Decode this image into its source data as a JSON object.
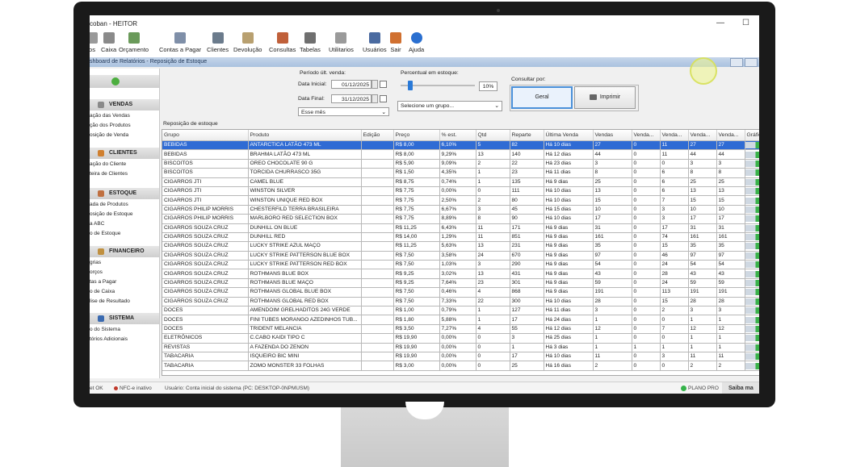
{
  "window": {
    "title": "coban - HEITOR",
    "minimize_glyph": "—",
    "maximize_glyph": "☐"
  },
  "toolbar": {
    "items": [
      {
        "label": "os",
        "icon": "document-icon",
        "color": "#9a9a9a"
      },
      {
        "label": "Caixa",
        "icon": "cart-icon",
        "color": "#8a8a8a"
      },
      {
        "label": "Orçamento",
        "icon": "calculator-icon",
        "color": "#6a9a5a"
      },
      {
        "label": "Contas a Pagar",
        "icon": "bills-icon",
        "color": "#7f8fa8"
      },
      {
        "label": "Clientes",
        "icon": "clients-icon",
        "color": "#6b7b8c"
      },
      {
        "label": "Devolução",
        "icon": "return-icon",
        "color": "#b8a070"
      },
      {
        "label": "Consultas",
        "icon": "consult-icon",
        "color": "#c0603a"
      },
      {
        "label": "Tabelas",
        "icon": "tables-icon",
        "color": "#6f6f6f"
      },
      {
        "label": "Utilitarios",
        "icon": "gear-icon",
        "color": "#9a9a9a"
      },
      {
        "label": "Usuários",
        "icon": "user-icon",
        "color": "#4a6aa0"
      },
      {
        "label": "Sair",
        "icon": "exit-icon",
        "color": "#d07030"
      },
      {
        "label": "Ajuda",
        "icon": "help-icon",
        "color": "#2a6fd0"
      }
    ]
  },
  "breadcrumb": "shboard de Relatórios - Reposição de Estoque",
  "sidebar": {
    "sections": [
      {
        "title": "VENDAS",
        "icon_color": "#8a8a8a",
        "items": [
          "ação das Vendas",
          "ção dos Produtos",
          "osição de Venda"
        ]
      },
      {
        "title": "CLIENTES",
        "icon_color": "#d08030",
        "items": [
          "ação do Cliente",
          "teira de Clientes"
        ]
      },
      {
        "title": "ESTOQUE",
        "icon_color": "#c07040",
        "items": [
          "ada de Produtos",
          "osição de Estoque",
          "a ABC",
          "o de Estoque"
        ]
      },
      {
        "title": "FINANCEIRO",
        "icon_color": "#c09040",
        "items": [
          "grias",
          "orços",
          "tas a Pagar",
          "o de Caixa",
          "lise de Resultado"
        ]
      },
      {
        "title": "SISTEMA",
        "icon_color": "#3a6ab0",
        "items": [
          "o do Sistema",
          "tórios Adicionais"
        ]
      }
    ]
  },
  "filters": {
    "period_label": "Período últ. venda:",
    "start_label": "Data Inicial:",
    "start_value": "01/12/2025",
    "end_label": "Data Final:",
    "end_value": "31/12/2025",
    "month_select": "Esse mês",
    "stock_percent_label": "Percentual em estoque:",
    "stock_percent_value": "10%",
    "stock_percent_fraction": 0.1,
    "group_select": "Selecione um grupo...",
    "consult_label": "Consultar por:",
    "general_button": "Geral",
    "print_button": "Imprimir"
  },
  "grid": {
    "title": "Reposição de estoque",
    "columns": [
      "Grupo",
      "Produto",
      "Edição",
      "Preço",
      "% est.",
      "Qtd",
      "Reparte",
      "Última Venda",
      "Vendas",
      "Venda...",
      "Venda...",
      "Venda...",
      "Venda...",
      "Gráfic"
    ],
    "rows": [
      [
        "BEBIDAS",
        "ANTARCTICA LATÃO 473 ML",
        "",
        "R$ 8,00",
        "6,10%",
        "5",
        "82",
        "Há 10 dias",
        "27",
        "0",
        "11",
        "27",
        "27"
      ],
      [
        "BEBIDAS",
        "BRAHMA LATÃO 473 ML",
        "",
        "R$ 8,00",
        "9,29%",
        "13",
        "140",
        "Há 12 dias",
        "44",
        "0",
        "11",
        "44",
        "44"
      ],
      [
        "BISCOITOS",
        "OREO CHOCOLATE 90 G",
        "",
        "R$ 5,90",
        "9,09%",
        "2",
        "22",
        "Há 23 dias",
        "3",
        "0",
        "0",
        "3",
        "3"
      ],
      [
        "BISCOITOS",
        "TORCIDA CHURRASCO 35G",
        "",
        "R$ 1,50",
        "4,35%",
        "1",
        "23",
        "Há 11 dias",
        "8",
        "0",
        "6",
        "8",
        "8"
      ],
      [
        "CIGARROS JTI",
        "CAMEL BLUE",
        "",
        "R$ 8,75",
        "0,74%",
        "1",
        "135",
        "Há 9 dias",
        "25",
        "0",
        "6",
        "25",
        "25"
      ],
      [
        "CIGARROS JTI",
        "WINSTON SILVER",
        "",
        "R$ 7,75",
        "0,00%",
        "0",
        "111",
        "Há 10 dias",
        "13",
        "0",
        "6",
        "13",
        "13"
      ],
      [
        "CIGARROS JTI",
        "WINSTON UNIQUE RED BOX",
        "",
        "R$ 7,75",
        "2,50%",
        "2",
        "80",
        "Há 10 dias",
        "15",
        "0",
        "7",
        "15",
        "15"
      ],
      [
        "CIGARROS PHILIP MORRIS",
        "CHESTERFILD TERRA BRASILEIRA",
        "",
        "R$ 7,75",
        "6,67%",
        "3",
        "45",
        "Há 15 dias",
        "10",
        "0",
        "3",
        "10",
        "10"
      ],
      [
        "CIGARROS PHILIP MORRIS",
        "MARLBORO RED SELECTION BOX",
        "",
        "R$ 7,75",
        "8,89%",
        "8",
        "90",
        "Há 10 dias",
        "17",
        "0",
        "3",
        "17",
        "17"
      ],
      [
        "CIGARROS SOUZA CRUZ",
        "DUNHILL ON BLUE",
        "",
        "R$ 11,25",
        "6,43%",
        "11",
        "171",
        "Há 9 dias",
        "31",
        "0",
        "17",
        "31",
        "31"
      ],
      [
        "CIGARROS SOUZA CRUZ",
        "DUNHILL RED",
        "",
        "R$ 14,00",
        "1,29%",
        "11",
        "851",
        "Há 9 dias",
        "161",
        "0",
        "74",
        "161",
        "161"
      ],
      [
        "CIGARROS SOUZA CRUZ",
        "LUCKY STRIKE AZUL MAÇO",
        "",
        "R$ 11,25",
        "5,63%",
        "13",
        "231",
        "Há 9 dias",
        "35",
        "0",
        "15",
        "35",
        "35"
      ],
      [
        "CIGARROS SOUZA CRUZ",
        "LUCKY STRIKE PATTERSON BLUE BOX",
        "",
        "R$ 7,50",
        "3,58%",
        "24",
        "670",
        "Há 9 dias",
        "97",
        "0",
        "46",
        "97",
        "97"
      ],
      [
        "CIGARROS SOUZA CRUZ",
        "LUCKY STRIKE PATTERSON RED BOX",
        "",
        "R$ 7,50",
        "1,03%",
        "3",
        "290",
        "Há 9 dias",
        "54",
        "0",
        "24",
        "54",
        "54"
      ],
      [
        "CIGARROS SOUZA CRUZ",
        "ROTHMANS BLUE BOX",
        "",
        "R$ 9,25",
        "3,02%",
        "13",
        "431",
        "Há 9 dias",
        "43",
        "0",
        "28",
        "43",
        "43"
      ],
      [
        "CIGARROS SOUZA CRUZ",
        "ROTHMANS BLUE MAÇO",
        "",
        "R$ 9,25",
        "7,64%",
        "23",
        "301",
        "Há 9 dias",
        "59",
        "0",
        "24",
        "59",
        "59"
      ],
      [
        "CIGARROS SOUZA CRUZ",
        "ROTHMANS GLOBAL BLUE BOX",
        "",
        "R$ 7,50",
        "0,46%",
        "4",
        "868",
        "Há 9 dias",
        "191",
        "0",
        "113",
        "191",
        "191"
      ],
      [
        "CIGARROS SOUZA CRUZ",
        "ROTHMANS GLOBAL RED BOX",
        "",
        "R$ 7,50",
        "7,33%",
        "22",
        "300",
        "Há 10 dias",
        "28",
        "0",
        "15",
        "28",
        "28"
      ],
      [
        "DOCES",
        "AMENDOIM GRELHADITOS 24G VERDE",
        "",
        "R$ 1,00",
        "0,79%",
        "1",
        "127",
        "Há 11 dias",
        "3",
        "0",
        "2",
        "3",
        "3"
      ],
      [
        "DOCES",
        "FINI TUBES MORANGO AZEDINHOS TUB...",
        "",
        "R$ 1,80",
        "5,88%",
        "1",
        "17",
        "Há 24 dias",
        "1",
        "0",
        "0",
        "1",
        "1"
      ],
      [
        "DOCES",
        "TRIDENT MELANCIA",
        "",
        "R$ 3,50",
        "7,27%",
        "4",
        "55",
        "Há 12 dias",
        "12",
        "0",
        "7",
        "12",
        "12"
      ],
      [
        "ELETRÔNICOS",
        "C.CABO KAIDI TIPO C",
        "",
        "R$ 19,90",
        "0,00%",
        "0",
        "3",
        "Há 25 dias",
        "1",
        "0",
        "0",
        "1",
        "1"
      ],
      [
        "REVISTAS",
        "A FAZENDA DO ZENON",
        "",
        "R$ 19,90",
        "0,00%",
        "0",
        "1",
        "Há 3 dias",
        "1",
        "1",
        "1",
        "1",
        "1"
      ],
      [
        "TABACARIA",
        "ISQUEIRO BIC MINI",
        "",
        "R$ 19,90",
        "0,00%",
        "0",
        "17",
        "Há 10 dias",
        "11",
        "0",
        "3",
        "11",
        "11"
      ],
      [
        "TABACARIA",
        "ZOMO MONSTER 33 FOLHAS",
        "",
        "R$ 3,00",
        "0,00%",
        "0",
        "25",
        "Há 16 dias",
        "2",
        "0",
        "0",
        "2",
        "2"
      ]
    ]
  },
  "statusbar": {
    "net": "et OK",
    "nfce": "NFC-e inativo",
    "user": "Usuário: Conta inicial do sistema (PC: DESKTOP-0NPMUSM)",
    "plan": "PLANO PRO",
    "more": "Saiba ma",
    "plan_color": "#35b34a",
    "nfce_color": "#c0392b"
  }
}
